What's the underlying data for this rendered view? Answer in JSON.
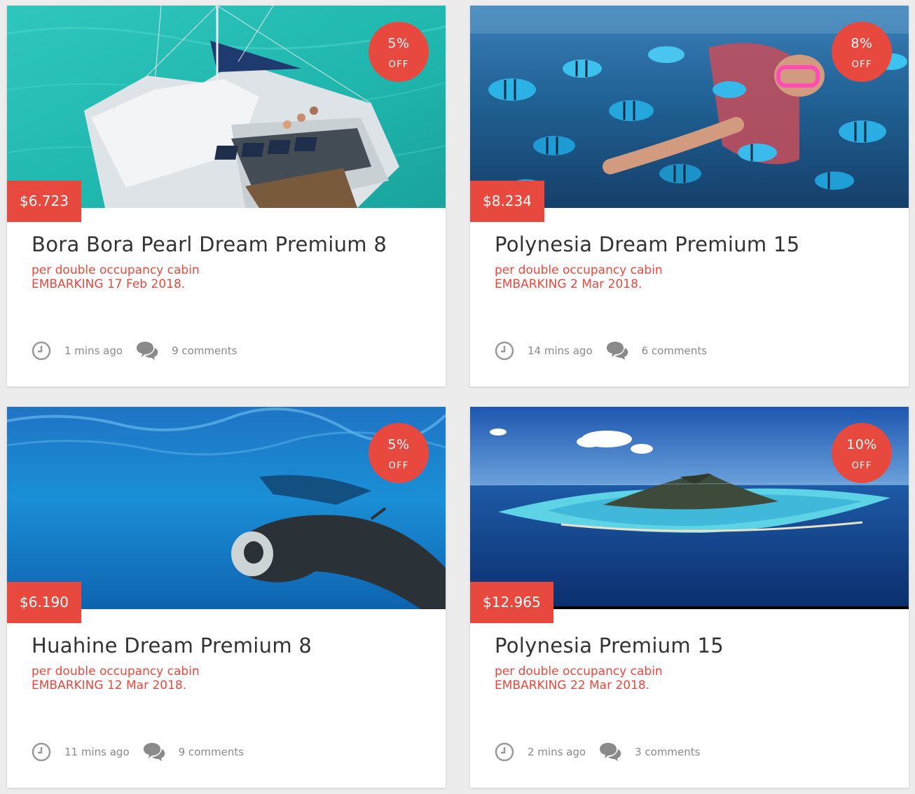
{
  "colors": {
    "accent": "#e8493f",
    "title": "#333333",
    "meta": "#8a8a8a",
    "background": "#ececec",
    "card": "#ffffff"
  },
  "cards": [
    {
      "image": "catamaran-turquoise-water",
      "discount_pct": "5%",
      "discount_off": "OFF",
      "price": "$6.723",
      "title": "Bora Bora Pearl Dream Premium 8",
      "subtitle_line1": "per double occupancy cabin",
      "subtitle_line2": "EMBARKING 17 Feb 2018.",
      "time_icon": "clock-icon",
      "time": "1 mins ago",
      "comments_icon": "comments-icon",
      "comments": "9 comments"
    },
    {
      "image": "snorkeler-with-fish",
      "discount_pct": "8%",
      "discount_off": "OFF",
      "price": "$8.234",
      "title": "Polynesia Dream Premium 15",
      "subtitle_line1": "per double occupancy cabin",
      "subtitle_line2": "EMBARKING 2 Mar 2018.",
      "time_icon": "clock-icon",
      "time": "14 mins ago",
      "comments_icon": "comments-icon",
      "comments": "6 comments"
    },
    {
      "image": "manta-ray-underwater",
      "discount_pct": "5%",
      "discount_off": "OFF",
      "price": "$6.190",
      "title": "Huahine Dream Premium 8",
      "subtitle_line1": "per double occupancy cabin",
      "subtitle_line2": "EMBARKING 12 Mar 2018.",
      "time_icon": "clock-icon",
      "time": "11 mins ago",
      "comments_icon": "comments-icon",
      "comments": "9 comments"
    },
    {
      "image": "island-aerial-lagoon",
      "discount_pct": "10%",
      "discount_off": "OFF",
      "price": "$12.965",
      "title": "Polynesia Premium 15",
      "subtitle_line1": "per double occupancy cabin",
      "subtitle_line2": "EMBARKING 22 Mar 2018.",
      "time_icon": "clock-icon",
      "time": "2 mins ago",
      "comments_icon": "comments-icon",
      "comments": "3 comments"
    }
  ]
}
